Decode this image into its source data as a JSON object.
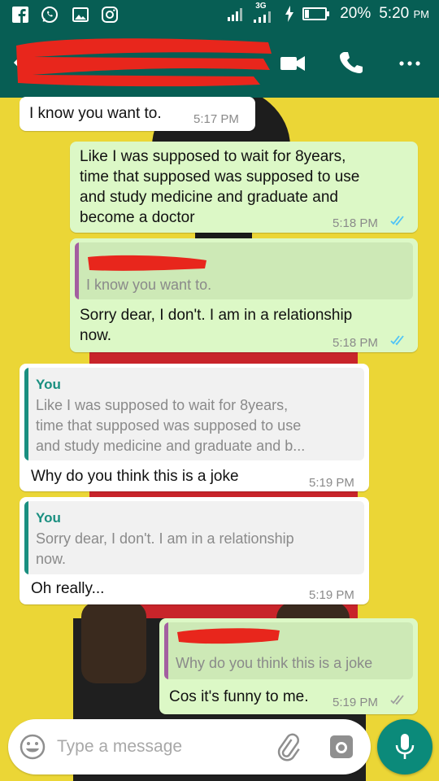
{
  "status_bar": {
    "network_type": "3G",
    "battery_percent": "20%",
    "battery_level": 0.2,
    "time": "5:20",
    "time_suffix": "PM",
    "icons": [
      "facebook-icon",
      "whatsapp-icon",
      "gallery-icon",
      "instagram-icon",
      "signal-icon",
      "charging-icon",
      "battery-icon"
    ]
  },
  "header": {
    "icons": [
      "back-arrow-icon",
      "video-call-icon",
      "voice-call-icon",
      "more-options-icon"
    ]
  },
  "messages": [
    {
      "id": "m1",
      "direction": "incoming",
      "text": "I know you want to.",
      "time": "5:17 PM"
    },
    {
      "id": "m2",
      "direction": "outgoing",
      "text": "Like I was supposed to wait for 8years,\ntime that supposed was supposed to use\nand study medicine and graduate and\nbecome a doctor",
      "time": "5:18 PM",
      "read": true
    },
    {
      "id": "m3",
      "direction": "outgoing",
      "quote": {
        "text": "I know you want to."
      },
      "text": "Sorry dear, I don't. I am in a relationship\nnow.",
      "time": "5:18 PM",
      "read": true
    },
    {
      "id": "m4",
      "direction": "incoming",
      "quote": {
        "author": "You",
        "text": "Like I was supposed to wait for 8years,\ntime that supposed was supposed to use\nand study medicine and graduate and b..."
      },
      "text": "Why do you think this is a joke",
      "time": "5:19 PM"
    },
    {
      "id": "m5",
      "direction": "incoming",
      "quote": {
        "author": "You",
        "text": "Sorry dear, I don't. I am in a relationship\nnow."
      },
      "text": "Oh really...",
      "time": "5:19 PM"
    },
    {
      "id": "m6",
      "direction": "outgoing",
      "quote": {
        "text": "Why do you think this is a joke"
      },
      "text": "Cos it's funny to me.",
      "time": "5:19 PM",
      "read": true
    }
  ],
  "composer": {
    "placeholder": "Type a message",
    "icons": [
      "emoji-icon",
      "attachment-icon",
      "camera-icon",
      "microphone-icon"
    ]
  },
  "colors": {
    "header": "#075e54",
    "incoming_bubble": "#ffffff",
    "outgoing_bubble": "#dcf8c6",
    "quote_author": "#1a8f80",
    "redaction": "#e8261c",
    "read_ticks": "#4fc3f7",
    "mic_button": "#0b8a7a",
    "wallpaper": "#ebd636"
  }
}
